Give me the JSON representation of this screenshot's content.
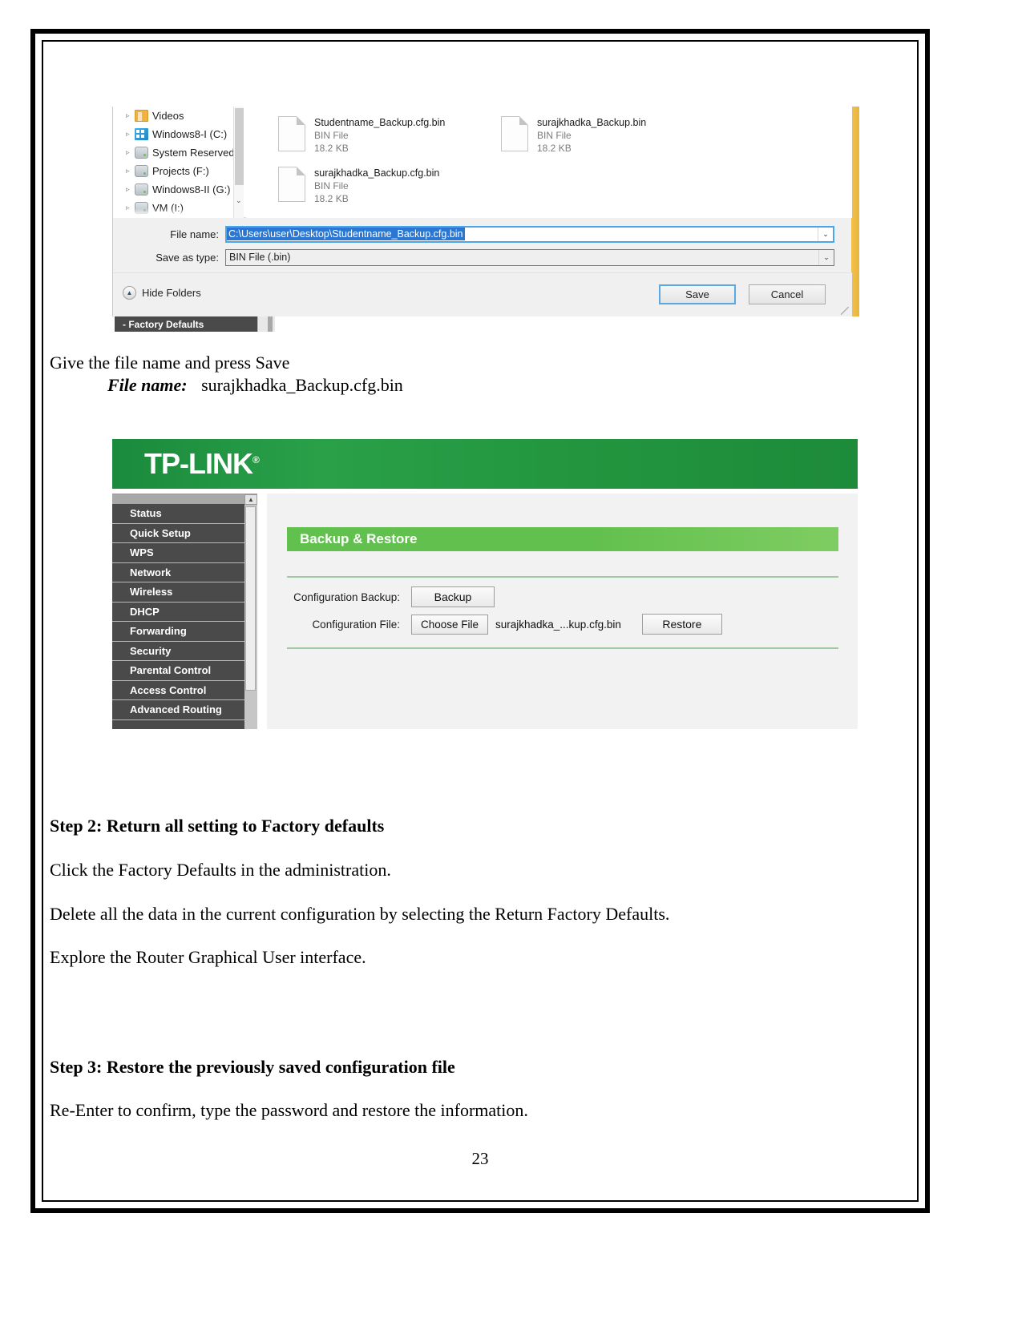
{
  "document": {
    "page_number": "23"
  },
  "save_dialog": {
    "tree_items": [
      {
        "label": "Videos",
        "icon": "videos-folder-icon",
        "caret": "▹"
      },
      {
        "label": "Windows8-I (C:)",
        "icon": "windows-drive-icon",
        "caret": "▹"
      },
      {
        "label": "System Reserved",
        "icon": "drive-icon",
        "caret": "▹"
      },
      {
        "label": "Projects (F:)",
        "icon": "drive-icon",
        "caret": "▹"
      },
      {
        "label": "Windows8-II (G:)",
        "icon": "drive-icon",
        "caret": "▹"
      },
      {
        "label": "VM (I:)",
        "icon": "drive-icon",
        "caret": "▹"
      }
    ],
    "files": [
      {
        "name": "Studentname_Backup.cfg.bin",
        "type": "BIN File",
        "size": "18.2 KB"
      },
      {
        "name": "surajkhadka_Backup.bin",
        "type": "BIN File",
        "size": "18.2 KB"
      },
      {
        "name": "surajkhadka_Backup.cfg.bin",
        "type": "BIN File",
        "size": "18.2 KB"
      }
    ],
    "file_name_label": "File name:",
    "file_name_value": "C:\\Users\\user\\Desktop\\Studentname_Backup.cfg.bin",
    "save_as_type_label": "Save as type:",
    "save_as_type_value": "BIN File (.bin)",
    "hide_folders_label": "Hide Folders",
    "save_button": "Save",
    "cancel_button": "Cancel",
    "factory_defaults_item": "- Factory Defaults",
    "dropdown_arrow": "⌄",
    "scroll_down_arrow": "⌄",
    "hide_folders_arrow": "▲"
  },
  "captions": {
    "line1": "Give the file name and press Save",
    "file_name_label": "File name:",
    "file_name_value": "surajkhadka_Backup.cfg.bin"
  },
  "router_ui": {
    "brand": "TP-LINK",
    "brand_mark": "®",
    "menu_items": [
      "Status",
      "Quick Setup",
      "WPS",
      "Network",
      "Wireless",
      "DHCP",
      "Forwarding",
      "Security",
      "Parental Control",
      "Access Control",
      "Advanced Routing"
    ],
    "panel_title": "Backup & Restore",
    "rows": {
      "backup_label": "Configuration Backup:",
      "backup_button": "Backup",
      "file_label": "Configuration File:",
      "choose_file_button": "Choose File",
      "chosen_file": "surajkhadka_...kup.cfg.bin",
      "restore_button": "Restore"
    },
    "scroll_up_arrow": "▲",
    "colors": {
      "header_green": "#1f8f3e",
      "panel_green": "#62c04e",
      "sidebar_gray": "#4a4a4a"
    }
  },
  "steps": {
    "step2_heading": "Step 2: Return all setting to Factory defaults",
    "step2_line1": "Click the Factory Defaults in the administration.",
    "step2_line2": "Delete all the data in the current configuration by selecting the Return Factory Defaults.",
    "step2_line3": "Explore the Router Graphical User interface.",
    "step3_heading": "Step 3: Restore the previously saved configuration file",
    "step3_line1": "Re-Enter to confirm, type the password and restore the information."
  }
}
